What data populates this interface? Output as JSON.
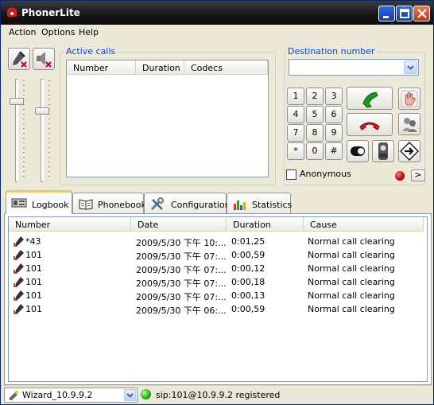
{
  "window": {
    "title": "PhonerLite"
  },
  "menu": [
    "Action",
    "Options",
    "Help"
  ],
  "active_calls": {
    "label": "Active calls",
    "columns": [
      "Number",
      "Duration",
      "Codecs"
    ]
  },
  "destination": {
    "label": "Destination number",
    "value": ""
  },
  "keypad": [
    "1",
    "2",
    "3",
    "4",
    "5",
    "6",
    "7",
    "8",
    "9",
    "*",
    "0",
    "#"
  ],
  "anonymous": {
    "label": "Anonymous",
    "checked": false
  },
  "forward_button_label": ">",
  "tabs": [
    {
      "label": "Logbook",
      "icon": "logbook-icon",
      "active": true
    },
    {
      "label": "Phonebook",
      "icon": "phonebook-icon",
      "active": false
    },
    {
      "label": "Configuration",
      "icon": "configuration-icon",
      "active": false
    },
    {
      "label": "Statistics",
      "icon": "statistics-icon",
      "active": false
    }
  ],
  "log": {
    "columns": [
      "Number",
      "Date",
      "Duration",
      "Cause"
    ],
    "rows": [
      {
        "number": "*43",
        "date": "2009/5/30 下午 10:...",
        "duration": "0:01,25",
        "cause": "Normal call clearing"
      },
      {
        "number": "101",
        "date": "2009/5/30 下午 07:...",
        "duration": "0:00,59",
        "cause": "Normal call clearing"
      },
      {
        "number": "101",
        "date": "2009/5/30 下午 07:...",
        "duration": "0:00,12",
        "cause": "Normal call clearing"
      },
      {
        "number": "101",
        "date": "2009/5/30 下午 07:...",
        "duration": "0:00,18",
        "cause": "Normal call clearing"
      },
      {
        "number": "101",
        "date": "2009/5/30 下午 07:...",
        "duration": "0:00,13",
        "cause": "Normal call clearing"
      },
      {
        "number": "101",
        "date": "2009/5/30 下午 06:...",
        "duration": "0:00,59",
        "cause": "Normal call clearing"
      }
    ]
  },
  "status": {
    "profile": "Wizard_10.9.9.2",
    "registration": "sip:101@10.9.9.2 registered",
    "color_registered": "#1cad12"
  },
  "sliders": {
    "microphone_level": 0.2,
    "speaker_level": 0.3
  }
}
